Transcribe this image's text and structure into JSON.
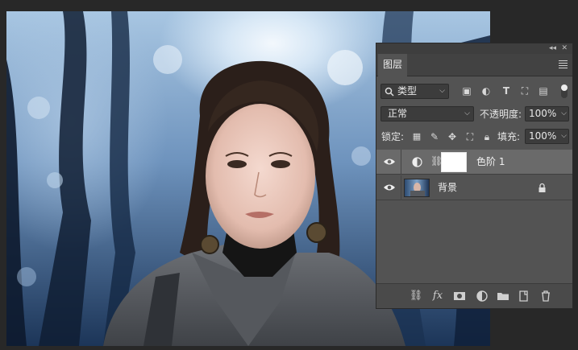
{
  "panel": {
    "tab_label": "图层",
    "filter_kind": "类型",
    "blend_mode": "正常",
    "opacity_label": "不透明度:",
    "opacity_value": "100%",
    "lock_label": "锁定:",
    "fill_label": "填充:",
    "fill_value": "100%"
  },
  "layers": [
    {
      "name": "色阶 1",
      "visible": true,
      "selected": true,
      "type": "levels-adjustment"
    },
    {
      "name": "背景",
      "visible": true,
      "selected": false,
      "type": "background",
      "locked": true
    }
  ],
  "filter_icons": [
    "image-filter-icon",
    "adjustment-filter-icon",
    "type-filter-icon",
    "shape-filter-icon",
    "smart-object-filter-icon"
  ],
  "lock_icons": [
    "lock-transparent-icon",
    "lock-paint-icon",
    "lock-position-icon",
    "lock-artboard-icon",
    "lock-all-icon"
  ],
  "bottom_icons": [
    "link-layers-icon",
    "fx-icon",
    "add-mask-icon",
    "new-adjustment-icon",
    "new-group-icon",
    "new-layer-icon",
    "delete-layer-icon"
  ],
  "colors": {
    "panel_bg": "#535353",
    "selected_row": "#6a6a6a",
    "app_bg": "#282828"
  }
}
